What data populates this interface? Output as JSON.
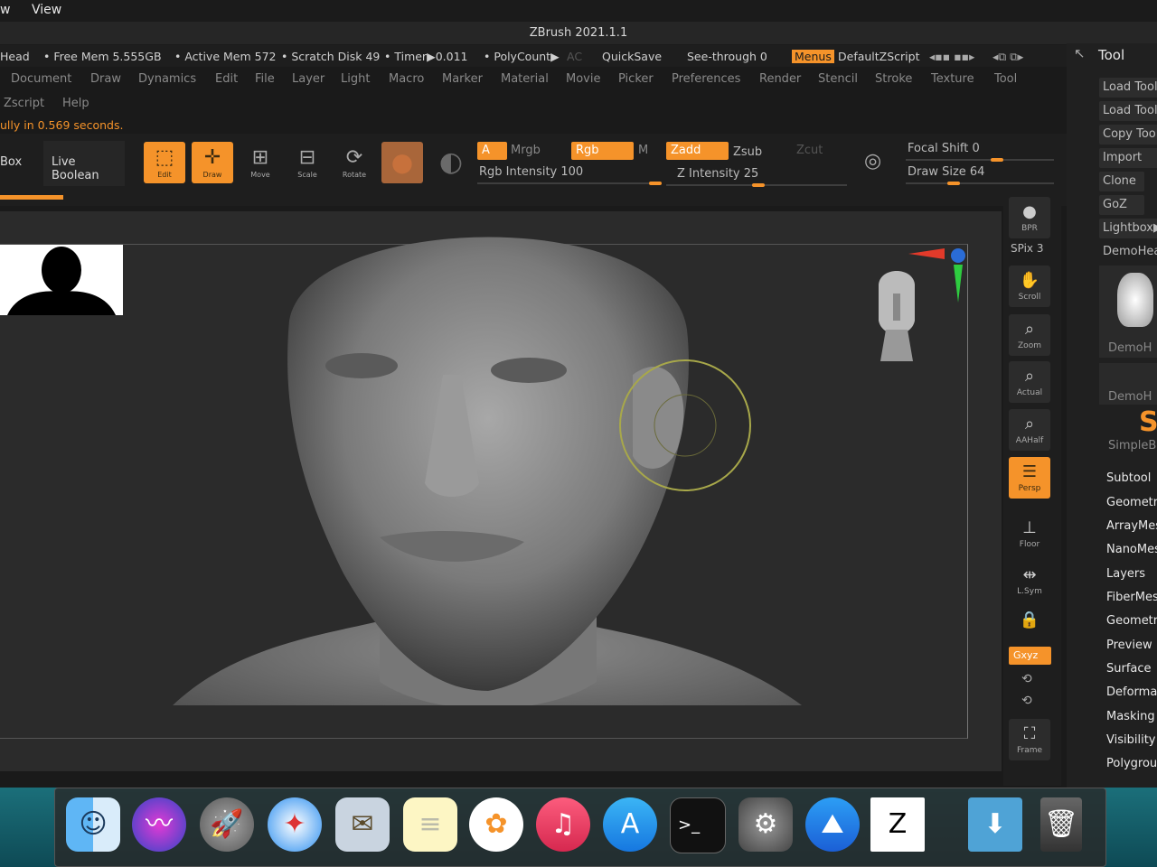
{
  "mac_menubar": {
    "items": [
      "w",
      "View"
    ]
  },
  "window": {
    "title": "ZBrush 2021.1.1"
  },
  "statusbar": {
    "project": "Head",
    "free_mem": "• Free Mem 5.555GB",
    "active_mem": "• Active Mem 572",
    "scratch_disk": "• Scratch Disk 49",
    "timer": "• Timer▶0.011",
    "polycount": "• PolyCount▶",
    "ac": "AC",
    "quicksave": "QuickSave",
    "see_through": "See-through  0",
    "menus": "Menus",
    "default_script": "DefaultZScript"
  },
  "main_menu": [
    "Document",
    "Draw",
    "Dynamics",
    "Edit",
    "File",
    "Layer",
    "Light",
    "Macro",
    "Marker",
    "Material",
    "Movie",
    "Picker",
    "Preferences",
    "Render",
    "Stencil",
    "Stroke",
    "Texture",
    "Tool"
  ],
  "main_menu2": [
    "Zscript",
    "Help"
  ],
  "notice": "ully in 0.569 seconds.",
  "toolbar": {
    "box": "Box",
    "live_boolean": "Live Boolean",
    "edit": "Edit",
    "draw": "Draw",
    "move": "Move",
    "scale": "Scale",
    "rotate": "Rotate",
    "a": "A",
    "mrgb": "Mrgb",
    "rgb": "Rgb",
    "m": "M",
    "rgb_intensity": "Rgb Intensity 100",
    "zadd": "Zadd",
    "zsub": "Zsub",
    "zcut": "Zcut",
    "z_intensity": "Z Intensity 25",
    "focal_shift": "Focal Shift 0",
    "draw_size": "Draw Size 64"
  },
  "right_shelf": {
    "bpr": "BPR",
    "spix": "SPix 3",
    "scroll": "Scroll",
    "zoom": "Zoom",
    "actual": "Actual",
    "aahalf": "AAHalf",
    "persp": "Persp",
    "floor": "Floor",
    "lsym": "L.Sym",
    "xyz": "Gxyz",
    "frame": "Frame"
  },
  "tool_panel": {
    "title": "Tool",
    "buttons": [
      "Load Tool",
      "Load Tool",
      "Copy Tool",
      "Import",
      "Clone",
      "GoZ",
      "Lightbox▶",
      "DemoHea"
    ],
    "thumbs": [
      "DemoH",
      "DemoH",
      "SimpleB"
    ],
    "sections": [
      "Subtool",
      "Geometry",
      "ArrayMesh",
      "NanoMesh",
      "Layers",
      "FiberMesh",
      "Geometry",
      "Preview",
      "Surface",
      "Deforma",
      "Masking",
      "Visibility",
      "Polygrou"
    ]
  },
  "dock": {
    "apps": [
      "finder-icon",
      "siri-icon",
      "launchpad-icon",
      "safari-icon",
      "mail-icon",
      "notes-icon",
      "photos-icon",
      "music-icon",
      "app-store-icon",
      "terminal-icon",
      "system-preferences-icon",
      "mountain-icon",
      "zbrush-icon",
      "downloads-icon",
      "trash-icon"
    ]
  },
  "colors": {
    "accent": "#f5932a",
    "panel": "#1e1e1e",
    "canvas": "#2b2b2b",
    "dock_bg": "#1b6f7a"
  }
}
